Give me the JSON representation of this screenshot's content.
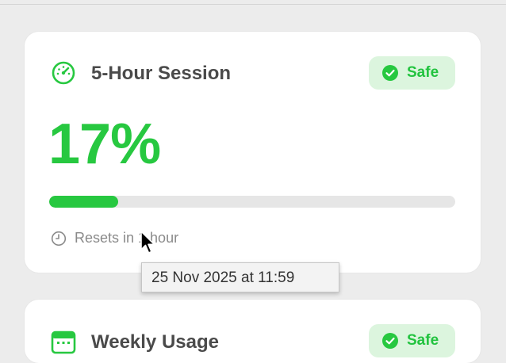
{
  "session_card": {
    "title": "5-Hour Session",
    "icon": "gauge-icon",
    "status_badge": {
      "label": "Safe",
      "icon": "checkmark-circle-icon"
    },
    "usage_percent_text": "17%",
    "usage_fraction": 0.17,
    "reset_icon": "clock-icon",
    "reset_text": "Resets in 1 hour"
  },
  "tooltip": {
    "text": "25 Nov 2025 at 11:59"
  },
  "weekly_card": {
    "title": "Weekly Usage",
    "icon": "calendar-icon",
    "status_badge": {
      "label": "Safe",
      "icon": "checkmark-circle-icon"
    }
  },
  "colors": {
    "accent_green": "#27c840",
    "badge_background": "#dcf5de",
    "window_background": "#ececec",
    "card_background": "#ffffff"
  }
}
